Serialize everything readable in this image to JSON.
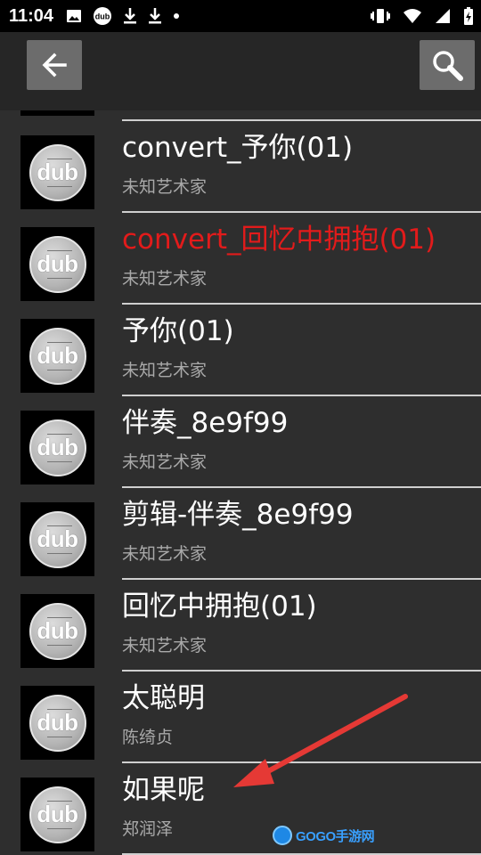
{
  "status_bar": {
    "time": "11:04",
    "left_icons": [
      "image-icon",
      "dub-icon",
      "download-icon",
      "download-icon",
      "dot-icon"
    ],
    "right_icons": [
      "vibrate-icon",
      "wifi-icon",
      "signal-icon",
      "battery-charging-icon"
    ],
    "dub_label": "dub"
  },
  "toolbar": {
    "back_icon": "arrow-left-icon",
    "search_icon": "search-icon"
  },
  "songs": [
    {
      "title": "convert_予你(01)",
      "artist": "未知艺术家",
      "active": false
    },
    {
      "title": "convert_回忆中拥抱(01)",
      "artist": "未知艺术家",
      "active": true
    },
    {
      "title": "予你(01)",
      "artist": "未知艺术家",
      "active": false
    },
    {
      "title": "伴奏_8e9f99",
      "artist": "未知艺术家",
      "active": false
    },
    {
      "title": "剪辑-伴奏_8e9f99",
      "artist": "未知艺术家",
      "active": false
    },
    {
      "title": "回忆中拥抱(01)",
      "artist": "未知艺术家",
      "active": false
    },
    {
      "title": "太聪明",
      "artist": "陈绮贞",
      "active": false
    },
    {
      "title": "如果呢",
      "artist": "郑润泽",
      "active": false
    }
  ],
  "thumb_label": "dub",
  "watermark": {
    "text": "GOGO手游网"
  },
  "colors": {
    "active_title": "#e21b1b",
    "arrow": "#e53935"
  }
}
